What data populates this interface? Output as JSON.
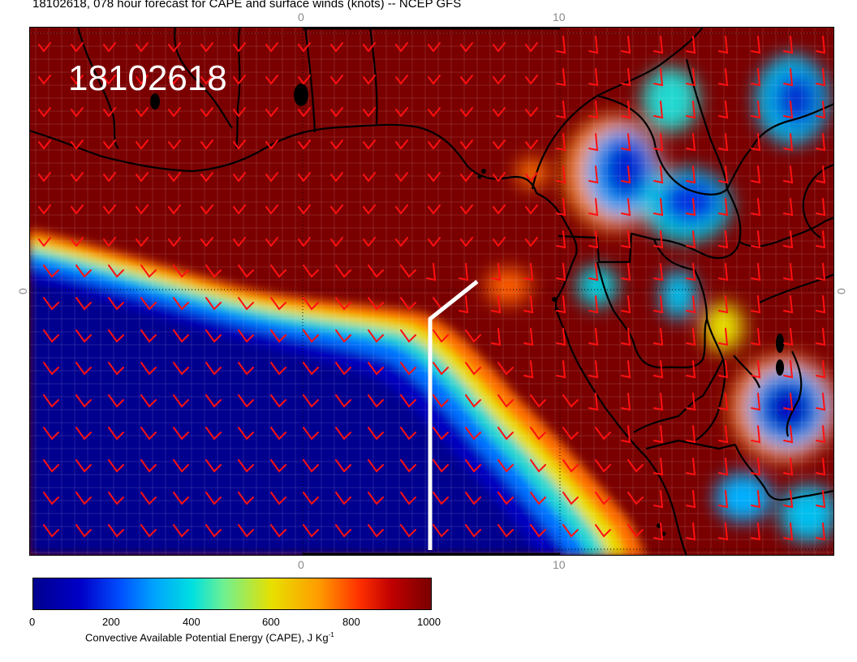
{
  "title": "18102618, 078 hour forecast for CAPE and surface winds (knots) -- NCEP GFS",
  "date_stamp": "18102618",
  "axis_ticks": {
    "top": [
      "0",
      "10"
    ],
    "bottom": [
      "0",
      "10"
    ],
    "left": [
      "0"
    ],
    "right": [
      "0"
    ]
  },
  "colorbar": {
    "labels": [
      "0",
      "200",
      "400",
      "600",
      "800",
      "1000"
    ],
    "caption": "Convective Available Potential Energy (CAPE), J Kg",
    "caption_superscript": "-1",
    "colors": [
      "#00008f",
      "#0000c8",
      "#0050ff",
      "#00a0ff",
      "#00e0e0",
      "#70f090",
      "#e8e000",
      "#ff9a00",
      "#ff3000",
      "#c00000",
      "#7a0000"
    ]
  },
  "colors": {
    "cape_high": "#7a0000",
    "cape_low": "#00008f",
    "barbs": "#ff1010",
    "coast": "#000000",
    "track": "#ffffff"
  }
}
